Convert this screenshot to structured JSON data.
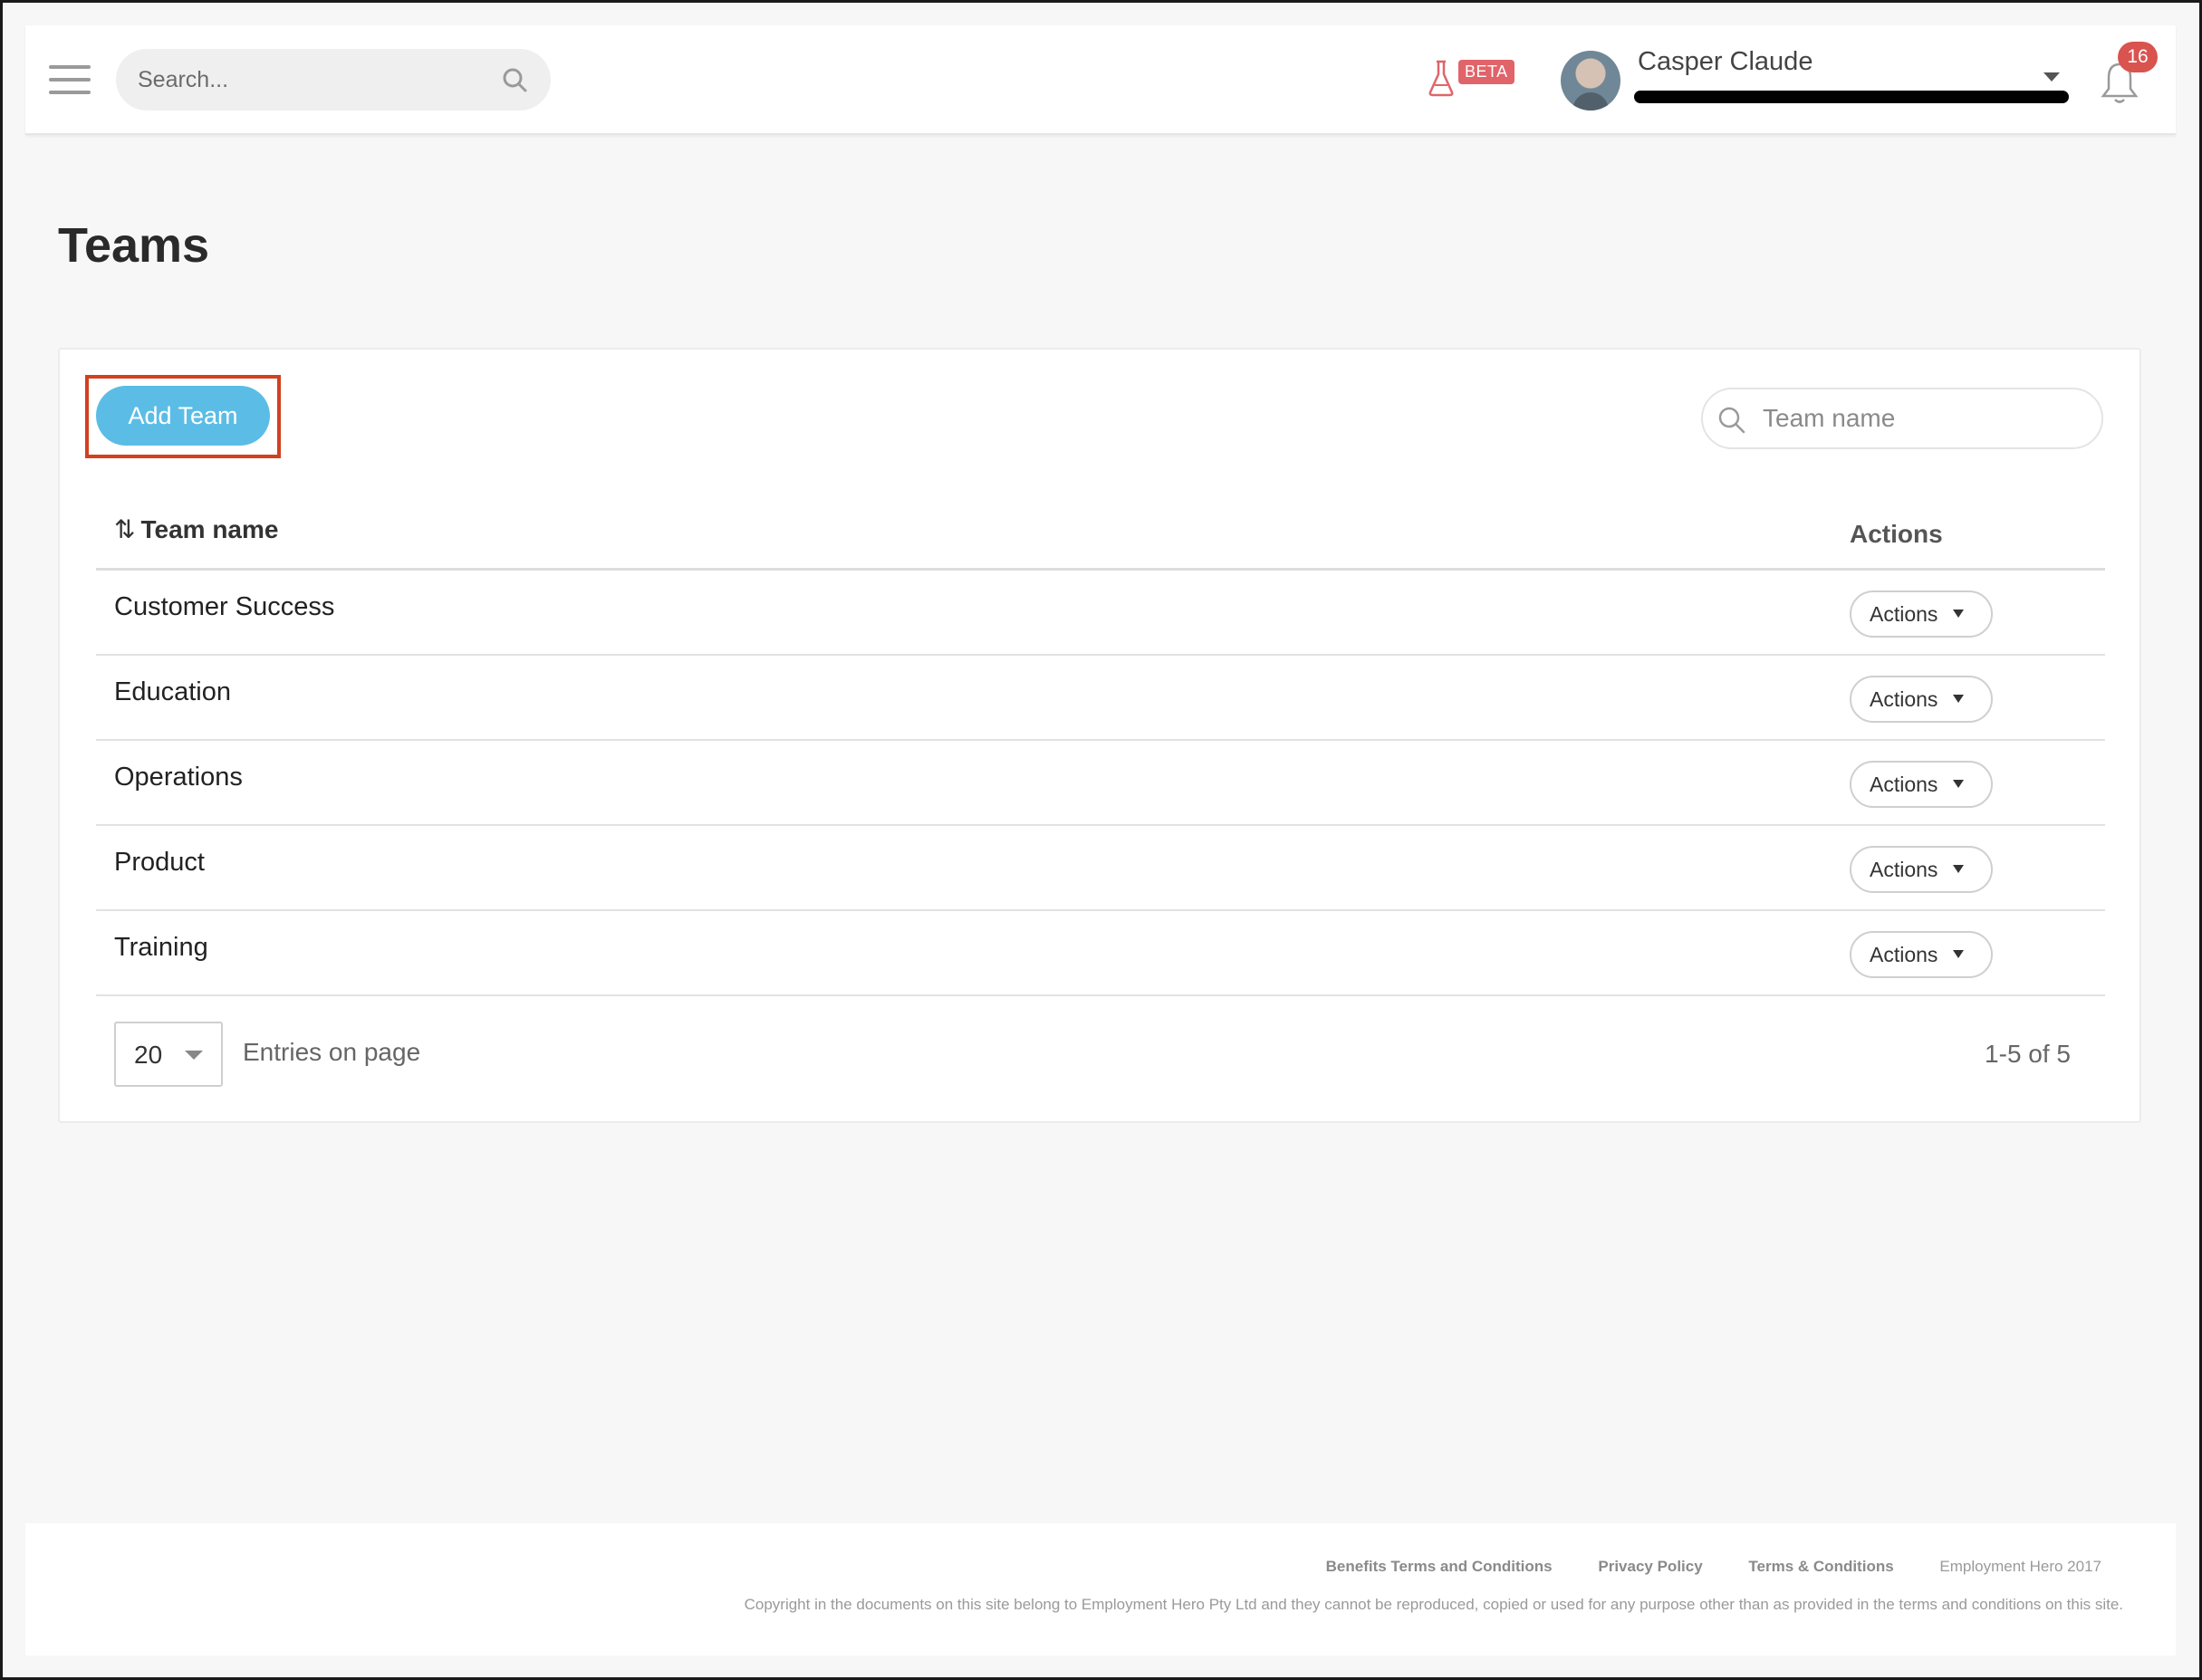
{
  "header": {
    "search_placeholder": "Search...",
    "beta_label": "BETA",
    "user_name": "Casper Claude",
    "notification_count": "16"
  },
  "page": {
    "title": "Teams"
  },
  "toolbar": {
    "add_team_label": "Add Team",
    "team_search_placeholder": "Team name"
  },
  "table": {
    "columns": [
      "Team name",
      "Actions"
    ],
    "rows": [
      {
        "name": "Customer Success",
        "action_label": "Actions"
      },
      {
        "name": "Education",
        "action_label": "Actions"
      },
      {
        "name": "Operations",
        "action_label": "Actions"
      },
      {
        "name": "Product",
        "action_label": "Actions"
      },
      {
        "name": "Training",
        "action_label": "Actions"
      }
    ]
  },
  "pagination": {
    "per_page": "20",
    "entries_label": "Entries on page",
    "range": "1-5 of 5"
  },
  "footer": {
    "links": [
      "Benefits Terms and Conditions",
      "Privacy Policy",
      "Terms & Conditions"
    ],
    "brand": "Employment Hero 2017",
    "copyright": "Copyright in the documents on this site belong to Employment Hero Pty Ltd and they cannot be reproduced, copied or used for any purpose other than as provided in the terms and conditions on this site."
  },
  "colors": {
    "accent": "#5bbde6",
    "highlight": "#d2401f",
    "badge": "#d9534f"
  },
  "icons": [
    "menu-icon",
    "search-icon",
    "flask-icon",
    "chevron-down-icon",
    "bell-icon",
    "sort-icon"
  ]
}
